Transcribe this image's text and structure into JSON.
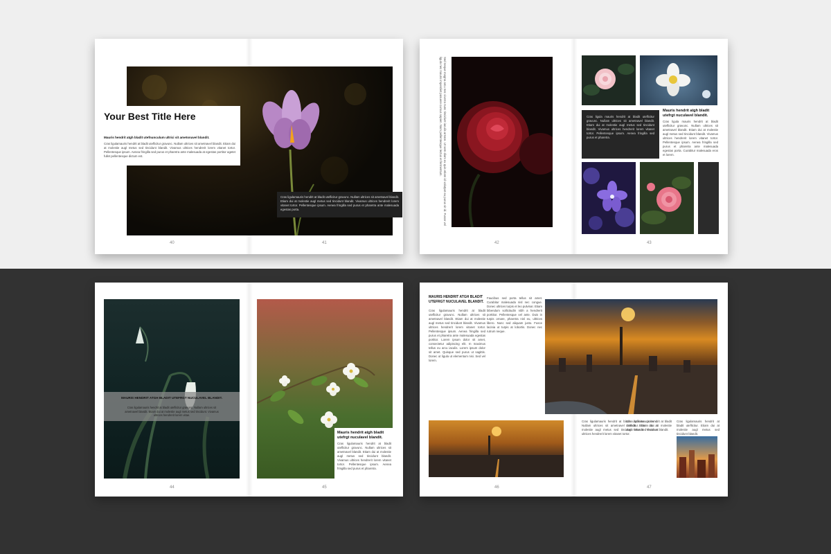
{
  "spread_a": {
    "title": "Your Best Title Here",
    "subtitle": "Mauris hendrit atgh bladit utefnunculum ultrici sit ametonavel blandit.",
    "intro": "Cras ligulamauris hendrit at bladit uteflicitur gravunc. Nullam ultrices sit ametnavel blandit. Etiam dui at molestie augl metus sed tincidunt blandit. Vivamus ultrices hendrerit lorem vitanet tortor. Pellentesque ipsum. Aenea fringilla sed purus et pharetra ante malesuada at egestas portitor agetet fullet pellentesque dictum est.",
    "caption": "Cras ligulamauris hendrit at bladit uteflicitur gravunc. Nullam ultrices sit ametnavel blandit. Etiam dui at molestie augl metus sed tincidunt blandit. Vivamus ultrices hendrerit lorem vitanet tortor. Pellentesque ipsum. Aenea fringilla sed purus et pharetra ante malesuada egestas porta.",
    "page_left": "40",
    "page_right": "41"
  },
  "spread_b": {
    "vertical_text": "Sed neque magna arcu nec viverra nunc tincidunt iaculis ornare. Ut sem diam ex quis etiam id volutpat eu purus sit id. Fusce vel ligula nec mauris imperdiet posuere cursus sapien. Nam pellentesque lectus et fermentum.",
    "heading": "Mauris hendrit atgh bladit utefrgt nuculavel blandit.",
    "dark_text": "Cras ligula mauris hendrit at bladit uteflicitur gravunc. Nullam ultrices sit ametnavel blandit. Etiam dui at molestie augl metus sed tincidunt blandit. Vivamus ultrices hendrerit lorem vitanet tortor. Pellentesque ipsum. Aenea fringilla sed purus et pharetra.",
    "right_text": "Cras ligula mauris hendrit at bladit uteflicitur gravunc. Nullam ultrices sit ametnavel blandit. Etiam dui at molestie augl metus sed tincidunt blandit. Vivamus ultrices hendrerit lorem vitanet tortor. Pellentesque ipsum. Aenea fringilla sed purus et pharetra ante malesuada egestas porta. Curabitur malesuada eros et lorem.",
    "page_left": "42",
    "page_right": "43"
  },
  "spread_c": {
    "overlay_heading": "MAURIS HENDRIT ATGH BLADIT UTEFRGT NUCULAVEL BLANDIT.",
    "overlay_text": "Cras ligulamauris hendrit at bladit uteflicitur gravunc. Nullam ultrices sit ametnavel blandit. Etiam dui at molestie augl metus sed tincidunt. Vivamus ultrices hendrerit lorem vitae.",
    "right_heading": "Mauris hendrit atgh bladit utefrgt nuculavel blandit.",
    "right_text": "Cras ligulamauris hendrit at bladit uteflicitur gravunc. Nullam ultrices sit ametnavel blandit. Etiam dui at molestie augl metus sed tincidunt blandit. Vivamus ultrices hendrerit lorem vitanet tortor. Pellentesque ipsum. Aenea fringilla sed purus et pharetra.",
    "page_left": "44",
    "page_right": "45"
  },
  "spread_d": {
    "heading": "MAURIS HENDRIT ATGH BLADIT UTEFRGT NUCULAVEL BLANDIT.",
    "col1": "Cras ligulamauris hendrit at bladit uteflicitur gravunc. Nullam ultrices sit ametnavel blandit. Etiam dui at molestie augl metus sed tincidunt blandit. Vivamus ultrices hendrerit lorem vitanet tortor. Pellentesque ipsum. Aenea fringilla sed purus et pharetra ante malesuada egestas portitor. Lorem ipsum dolor sit amet, consectetur adipiscing elit. In maximus tellus eu arcu iaculis. Lorem ipsum dolor sit amet. Quisque sed purus ut sagittis. Donec ut ligula ut elementum nisi. Sed vel lorem.",
    "col2": "Faucibus sed porta tellus sit amet. Curabitur malesuada nisl nec congue. Donec ultrices turpis et leo pulvinar. Etiam bibendum sollicitudin nibh a hendrerit porttitor. Pellentesque vel ante. Duis in turpis ornare, pharetra nisl eu, ultrices libero. Nunc sed aliquam justo. Fusce lacinia ut turpis at lobortis. Donec nec rutrum neque.",
    "col3": "Cras ligulamauris hendrit at bladit uteflicitur gravunc. Nullam ultrices sit ametnavel blandit. Etiam dui at molestie augl metus sed tincidunt blandit. Vivamus ultrices hendrerit lorem vitanet tortor.",
    "col4": "Cras ligulamauris hendrit at bladit uteflicitur. Etiam dui at molestie augl metus sed tincidunt blandit.",
    "page_left": "46",
    "page_right": "47"
  }
}
